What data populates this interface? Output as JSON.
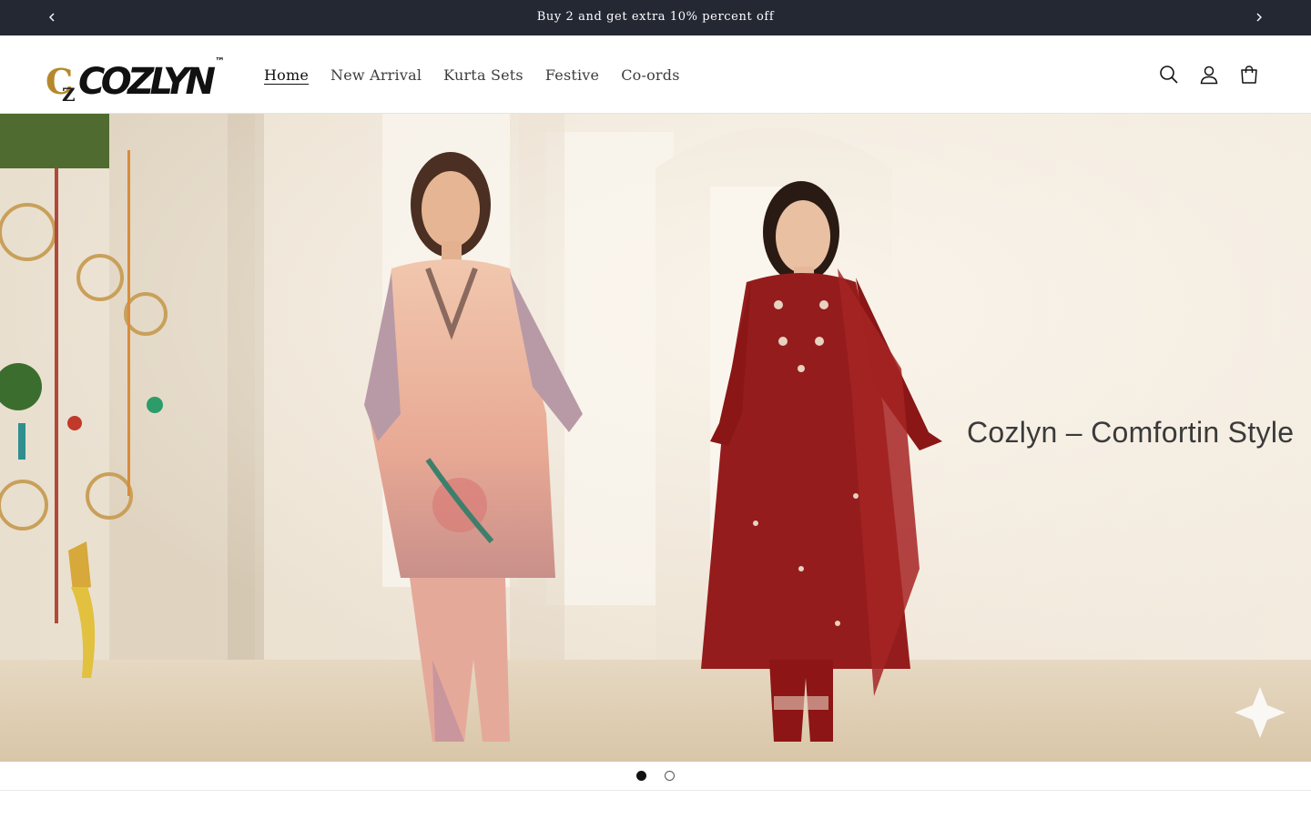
{
  "announcement": {
    "text": "Buy 2 and get extra 10% percent off",
    "prev_icon": "chevron-left-icon",
    "next_icon": "chevron-right-icon"
  },
  "header": {
    "logo_mark": "CZ",
    "logo_text": "COZLYN",
    "logo_tm": "™",
    "nav": [
      {
        "label": "Home",
        "active": true
      },
      {
        "label": "New Arrival",
        "active": false
      },
      {
        "label": "Kurta Sets",
        "active": false
      },
      {
        "label": "Festive",
        "active": false
      },
      {
        "label": "Co-ords",
        "active": false
      }
    ],
    "icons": [
      "search-icon",
      "account-icon",
      "cart-icon"
    ]
  },
  "hero": {
    "caption": "Cozlyn – Comfortin Style",
    "slides_total": 2,
    "active_slide": 1
  },
  "colors": {
    "announcement_bg": "#242833",
    "text": "#121212",
    "hero_bg": "#efe6d8",
    "red_outfit": "#8e1515",
    "peach_outfit": "#e8b39a"
  }
}
